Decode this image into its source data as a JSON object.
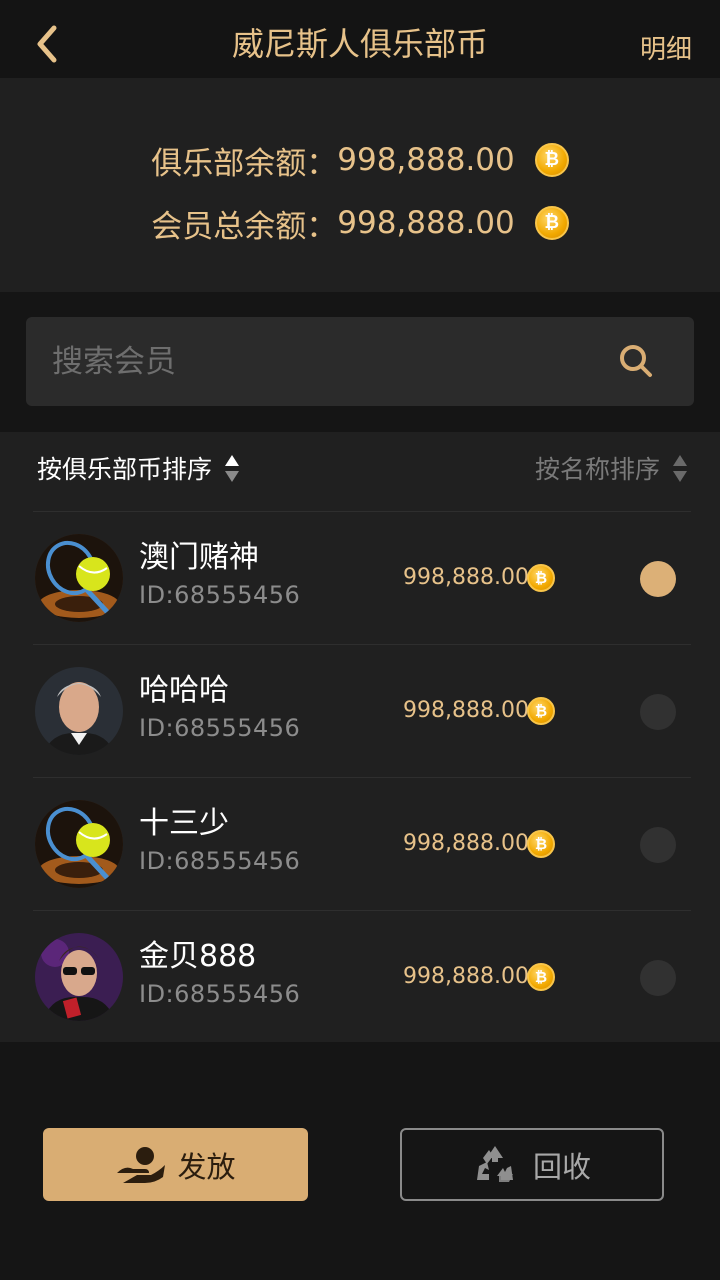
{
  "header": {
    "title": "威尼斯人俱乐部币",
    "detail_label": "明细"
  },
  "balances": {
    "club_label": "俱乐部余额：",
    "club_value": "998,888.00",
    "member_label": "会员总余额：",
    "member_value": "998,888.00"
  },
  "search": {
    "placeholder": "搜索会员"
  },
  "sort": {
    "by_coin_label": "按俱乐部币排序",
    "by_name_label": "按名称排序"
  },
  "members": [
    {
      "name": "澳门赌神",
      "id": "ID:68555456",
      "amount": "998,888.00",
      "selected": true,
      "avatar": "tennis-avatar"
    },
    {
      "name": "哈哈哈",
      "id": "ID:68555456",
      "amount": "998,888.00",
      "selected": false,
      "avatar": "gentleman-avatar"
    },
    {
      "name": "十三少",
      "id": "ID:68555456",
      "amount": "998,888.00",
      "selected": false,
      "avatar": "tennis-avatar"
    },
    {
      "name": "金贝888",
      "id": "ID:68555456",
      "amount": "998,888.00",
      "selected": false,
      "avatar": "sunglasses-avatar"
    }
  ],
  "actions": {
    "issue_label": "发放",
    "recycle_label": "回收"
  },
  "colors": {
    "accent_gold": "#e7c28a",
    "button_gold": "#d9ad73",
    "coin": "#f2a900"
  },
  "icons": {
    "coin": "bitcoin-coin-icon",
    "back": "chevron-left-icon",
    "search": "search-icon",
    "issue": "hand-coin-icon",
    "recycle": "recycle-icon"
  }
}
